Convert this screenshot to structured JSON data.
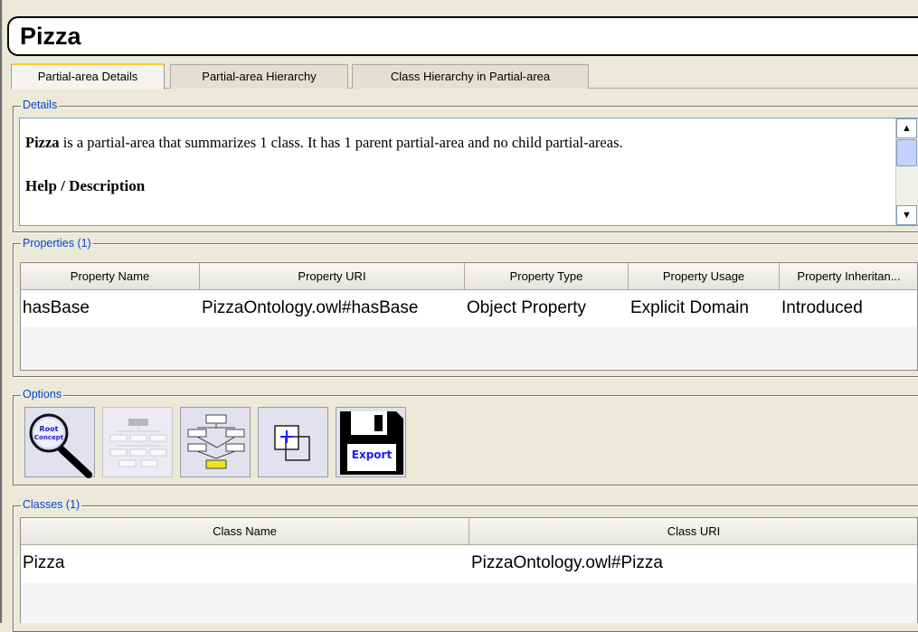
{
  "title": "Pizza",
  "tabs": [
    {
      "label": "Partial-area Details",
      "active": true
    },
    {
      "label": "Partial-area Hierarchy",
      "active": false
    },
    {
      "label": "Class Hierarchy in Partial-area",
      "active": false
    }
  ],
  "details": {
    "group_label": "Details",
    "name": "Pizza",
    "summary": " is a partial-area that summarizes 1 class. It has 1 parent partial-area and no child partial-areas.",
    "help_heading": "Help / Description"
  },
  "properties": {
    "group_label": "Properties (1)",
    "columns": [
      "Property Name",
      "Property URI",
      "Property Type",
      "Property Usage",
      "Property Inheritan..."
    ],
    "rows": [
      [
        "hasBase",
        "PizzaOntology.owl#hasBase",
        "Object Property",
        "Explicit Domain",
        "Introduced"
      ]
    ]
  },
  "options": {
    "group_label": "Options",
    "buttons": [
      {
        "name": "root-concept-search-button",
        "icon": "magnifier-icon",
        "label": "Root Concept"
      },
      {
        "name": "hierarchy-view-button",
        "icon": "hierarchy-disabled-icon",
        "label": ""
      },
      {
        "name": "class-hierarchy-button",
        "icon": "class-hierarchy-icon",
        "label": ""
      },
      {
        "name": "expand-button",
        "icon": "expand-icon",
        "label": ""
      },
      {
        "name": "export-button",
        "icon": "floppy-disk-icon",
        "label": "Export"
      }
    ]
  },
  "classes": {
    "group_label": "Classes (1)",
    "columns": [
      "Class Name",
      "Class URI"
    ],
    "rows": [
      [
        "Pizza",
        "PizzaOntology.owl#Pizza"
      ]
    ]
  },
  "colors": {
    "window_bg": "#ece9d8",
    "group_label": "#0046d5",
    "active_tab_accent": "#ffc83c",
    "export_blue": "#1a1aff"
  }
}
